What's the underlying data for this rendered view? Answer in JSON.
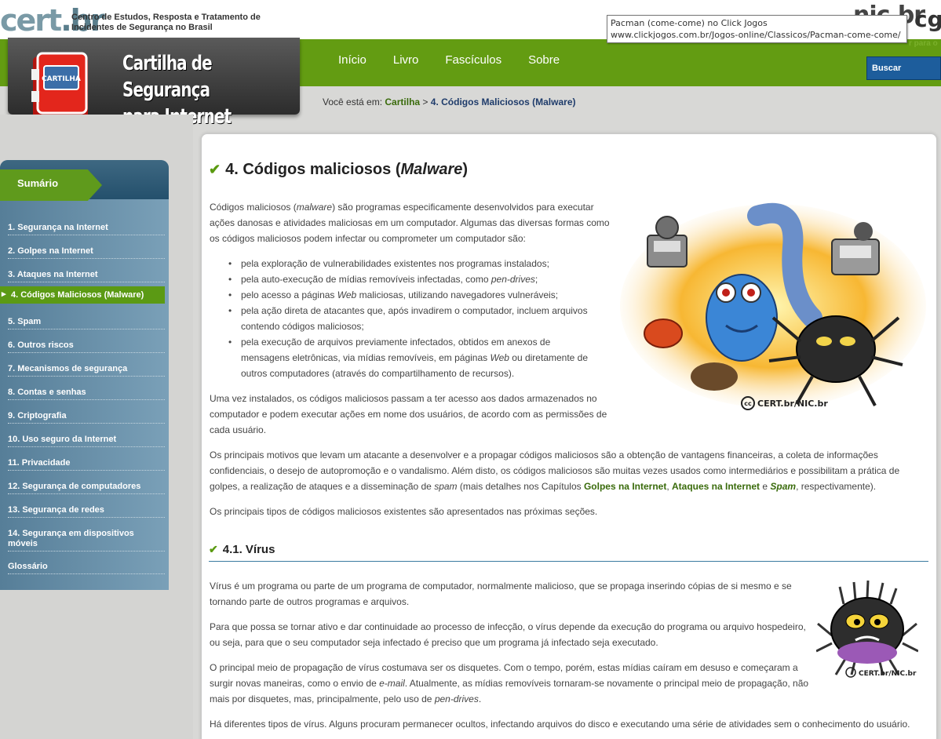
{
  "header": {
    "cert_logo": "cert",
    "cert_logo_br": ".br",
    "cert_description": "Centro de Estudos, Resposta e Tratamento de Incidentes de Segurança no Brasil",
    "nic_logo": "nic.br",
    "cg_logo": "cg",
    "right_cut_text": "r para o",
    "tooltip_line1": "Pacman (come-come) no Click Jogos",
    "tooltip_line2": "www.clickjogos.com.br/Jogos-online/Classicos/Pacman-come-come/"
  },
  "banner": {
    "icon_label": "CARTILHA",
    "title_line1": "Cartilha de Segurança",
    "title_line2": "para Internet"
  },
  "nav": {
    "items": [
      "Início",
      "Livro",
      "Fascículos",
      "Sobre"
    ],
    "search_placeholder": "Buscar"
  },
  "breadcrumb": {
    "prefix": "Você está em:",
    "link": "Cartilha",
    "separator": ">",
    "current": "4. Códigos Maliciosos (Malware)"
  },
  "sidebar": {
    "title": "Sumário",
    "items": [
      "1. Segurança na Internet",
      "2. Golpes na Internet",
      "3. Ataques na Internet",
      "4. Códigos Maliciosos (Malware)",
      "5. Spam",
      "6. Outros riscos",
      "7. Mecanismos de segurança",
      "8. Contas e senhas",
      "9. Criptografia",
      "10. Uso seguro da Internet",
      "11. Privacidade",
      "12. Segurança de computadores",
      "13. Segurança de redes",
      "14. Segurança em dispositivos móveis",
      "Glossário"
    ],
    "active_index": 3
  },
  "main": {
    "h1_prefix": "4. Códigos maliciosos (",
    "h1_italic": "Malware",
    "h1_suffix": ")",
    "intro_a": "Códigos maliciosos (",
    "intro_b": "malware",
    "intro_c": ") são programas especificamente desenvolvidos para executar ações danosas e atividades maliciosas em um computador. Algumas das diversas formas como os códigos maliciosos podem infectar ou comprometer um computador são:",
    "bullet1": "pela exploração de vulnerabilidades existentes nos programas instalados;",
    "bullet2_a": "pela auto-execução de mídias removíveis infectadas, como ",
    "bullet2_b": "pen-drives",
    "bullet2_c": ";",
    "bullet3_a": "pelo acesso a páginas ",
    "bullet3_b": "Web",
    "bullet3_c": " maliciosas, utilizando navegadores vulneráveis;",
    "bullet4": "pela ação direta de atacantes que, após invadirem o computador, incluem arquivos contendo códigos maliciosos;",
    "bullet5_a": "pela execução de arquivos previamente infectados, obtidos em anexos de mensagens eletrônicas, via mídias removíveis, em páginas ",
    "bullet5_b": "Web",
    "bullet5_c": " ou diretamente de outros computadores (através do compartilhamento de recursos).",
    "para_installed": "Uma vez instalados, os códigos maliciosos passam a ter acesso aos dados armazenados no computador e podem executar ações em nome dos usuários, de acordo com as permissões de cada usuário.",
    "para_motives_a": "Os principais motivos que levam um atacante a desenvolver e a propagar códigos maliciosos são a obtenção de vantagens financeiras, a coleta de informações confidenciais, o desejo de autopromoção e o vandalismo. Além disto, os códigos maliciosos são muitas vezes usados como intermediários e possibilitam a prática de golpes, a realização de ataques e a disseminação de ",
    "para_motives_spam": "spam",
    "para_motives_b": " (mais detalhes nos Capítulos ",
    "link_golpes": "Golpes na Internet",
    "para_motives_c": ", ",
    "link_ataques": "Ataques na Internet",
    "para_motives_d": " e ",
    "link_spam": "Spam",
    "para_motives_e": ", respectivamente).",
    "para_types": "Os principais tipos de códigos maliciosos existentes são apresentados nas próximas seções.",
    "h2": "4.1. Vírus",
    "virus_p1": "Vírus é um programa ou parte de um programa de computador, normalmente malicioso, que se propaga inserindo cópias de si mesmo e se tornando parte de outros programas e arquivos.",
    "virus_p2": "Para que possa se tornar ativo e dar continuidade ao processo de infecção, o vírus depende da execução do programa ou arquivo hospedeiro, ou seja, para que o seu computador seja infectado é preciso que um programa já infectado seja executado.",
    "virus_p3_a": "O principal meio de propagação de vírus costumava ser os disquetes. Com o tempo, porém, estas mídias caíram em desuso e começaram a surgir novas maneiras, como o envio de ",
    "virus_p3_b": "e-mail",
    "virus_p3_c": ". Atualmente, as mídias removíveis tornaram-se novamente o principal meio de propagação, não mais por disquetes, mas, principalmente, pelo uso de ",
    "virus_p3_d": "pen-drives",
    "virus_p3_e": ".",
    "virus_p4": "Há diferentes tipos de vírus. Alguns procuram permanecer ocultos, infectando arquivos do disco e executando uma série de atividades sem o conhecimento do usuário.",
    "credit_main": "CERT.br/NIC.br",
    "credit_virus": "CERT.br/NIC.br",
    "cc_symbol": "cc"
  },
  "colors": {
    "green": "#639c12",
    "link_green": "#3a6b0c",
    "sidebar_blue": "#567e98",
    "search_blue": "#1d5d9c"
  }
}
